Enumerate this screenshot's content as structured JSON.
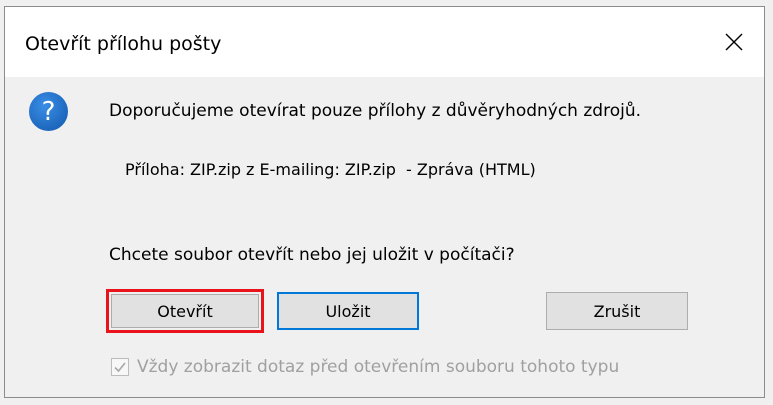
{
  "window": {
    "title": "Otevřít přílohu pošty"
  },
  "dialog": {
    "message": "Doporučujeme otevírat pouze přílohy z důvěryhodných zdrojů.",
    "attachment_info": "Příloha: ZIP.zip z E-mailing: ZIP.zip  - Zpráva (HTML)",
    "prompt": "Chcete soubor otevřít nebo jej uložit v počítači?",
    "icon": "question-icon"
  },
  "buttons": {
    "open_label": "Otevřít",
    "save_label": "Uložit",
    "cancel_label": "Zrušit"
  },
  "checkbox": {
    "label": "Vždy zobrazit dotaz před otevřením souboru tohoto typu",
    "checked": true,
    "disabled": true
  },
  "colors": {
    "highlight_border": "#e8131b",
    "focus_border": "#0078d7",
    "icon_fill": "#1e6fc8"
  }
}
